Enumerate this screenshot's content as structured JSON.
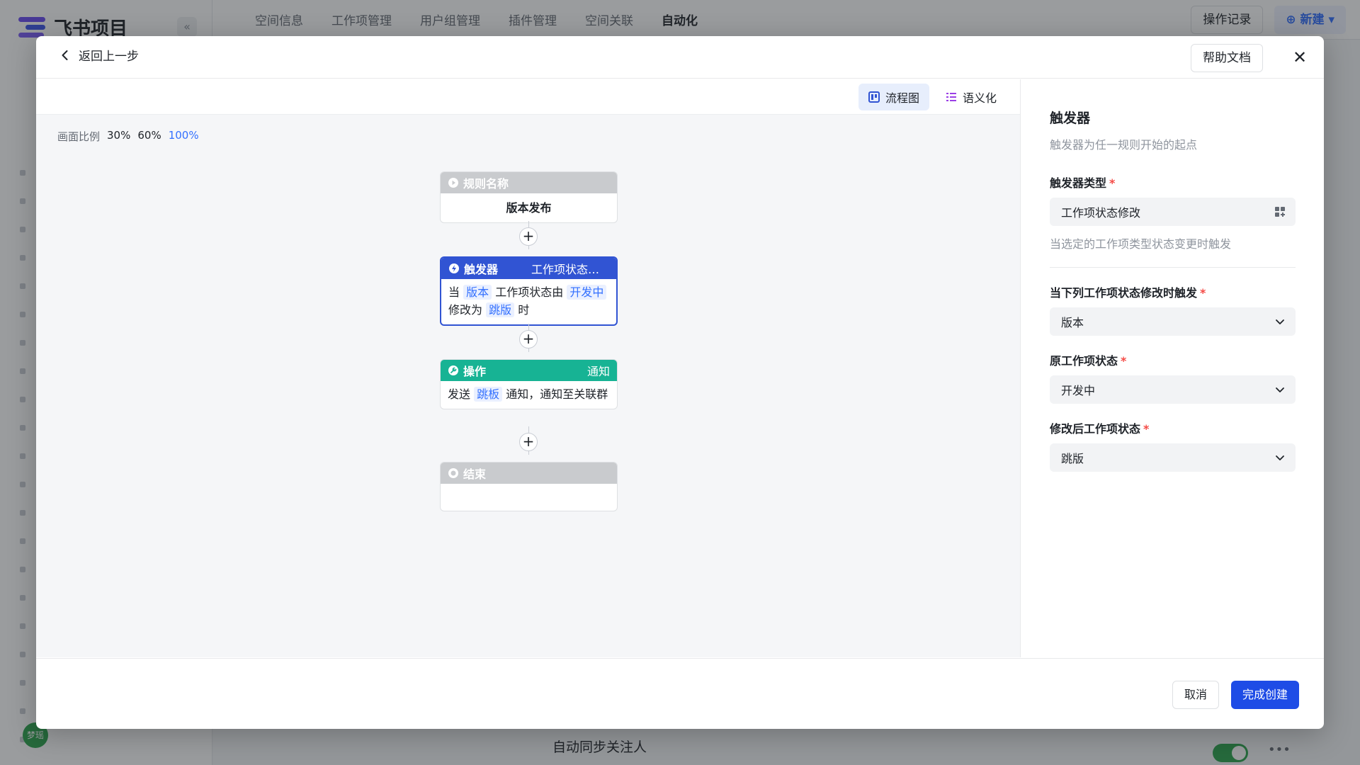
{
  "background": {
    "app_name": "飞书项目",
    "collapse_icon": "«",
    "top_nav": [
      "空间信息",
      "工作项管理",
      "用户组管理",
      "插件管理",
      "空间关联",
      "自动化"
    ],
    "active_nav": "自动化",
    "ops_log_label": "操作记录",
    "new_label": "新建",
    "avatar_text": "梦瑶",
    "bottom_row_text": "自动同步关注人"
  },
  "modal": {
    "back_label": "返回上一步",
    "help_label": "帮助文档",
    "close_icon": "✕",
    "view_flow_label": "流程图",
    "view_semantic_label": "语义化",
    "zoom_label": "画面比例",
    "zoom_options": [
      "30%",
      "60%",
      "100%"
    ],
    "zoom_active": "100%",
    "nodes": {
      "rule": {
        "title": "规则名称",
        "body": "版本发布"
      },
      "trigger": {
        "title": "触发器",
        "tag": "工作项状态修改",
        "text_1": "当",
        "chip_1": "版本",
        "text_2": "工作项状态由",
        "chip_2": "开发中",
        "text_3": "修改为",
        "chip_3": "跳版",
        "text_4": "时"
      },
      "action": {
        "title": "操作",
        "tag": "通知",
        "text_1": "发送",
        "chip_1": "跳板",
        "text_2": "通知，通知至关联群"
      },
      "end": {
        "title": "结束"
      }
    },
    "add_icon": "+",
    "panel": {
      "title": "触发器",
      "subtitle": "触发器为任一规则开始的起点",
      "trigger_type_label": "触发器类型",
      "trigger_type_value": "工作项状态修改",
      "trigger_type_hint": "当选定的工作项类型状态变更时触发",
      "work_item_label": "当下列工作项状态修改时触发",
      "work_item_value": "版本",
      "from_state_label": "原工作项状态",
      "from_state_value": "开发中",
      "to_state_label": "修改后工作项状态",
      "to_state_value": "跳版",
      "required_mark": "*"
    },
    "cancel_label": "取消",
    "create_label": "完成创建"
  },
  "colors": {
    "trigger": "#3154d3",
    "action": "#17b394",
    "neutral_node": "#c9cbce",
    "primary": "#1e4ce6",
    "link": "#3370ff"
  }
}
